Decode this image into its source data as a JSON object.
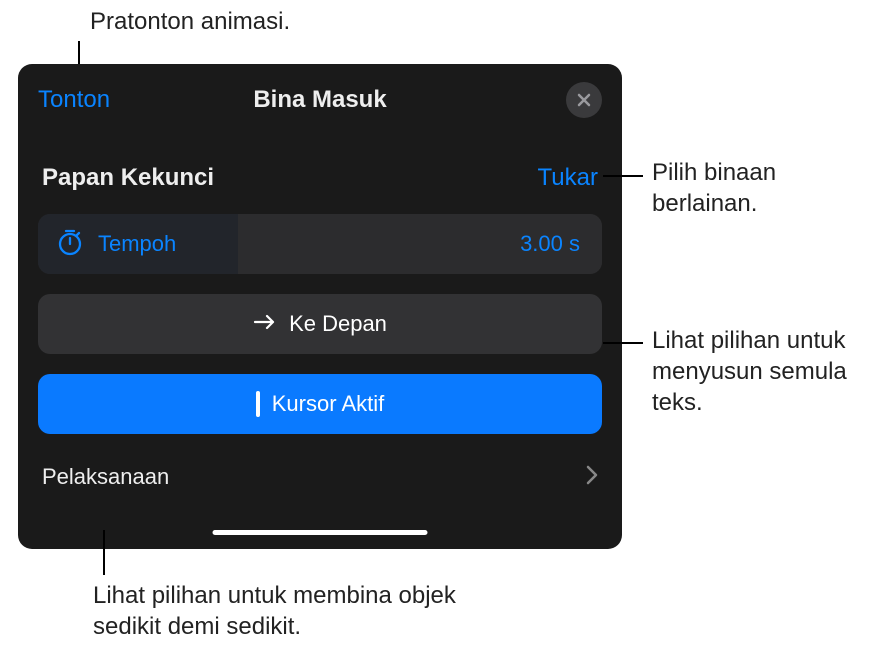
{
  "callouts": {
    "preview": "Pratonton animasi.",
    "choose_different": "Pilih binaan berlainan.",
    "reorder_text": "Lihat pilihan untuk menyusun semula teks.",
    "build_gradually": "Lihat pilihan untuk membina objek sedikit demi sedikit."
  },
  "panel": {
    "watch_link": "Tonton",
    "title": "Bina Masuk",
    "section_label": "Papan Kekunci",
    "change_link": "Tukar",
    "duration": {
      "label": "Tempoh",
      "value": "3.00 s"
    },
    "direction_button": "Ke Depan",
    "cursor_button": "Kursor Aktif",
    "delivery_label": "Pelaksanaan"
  }
}
